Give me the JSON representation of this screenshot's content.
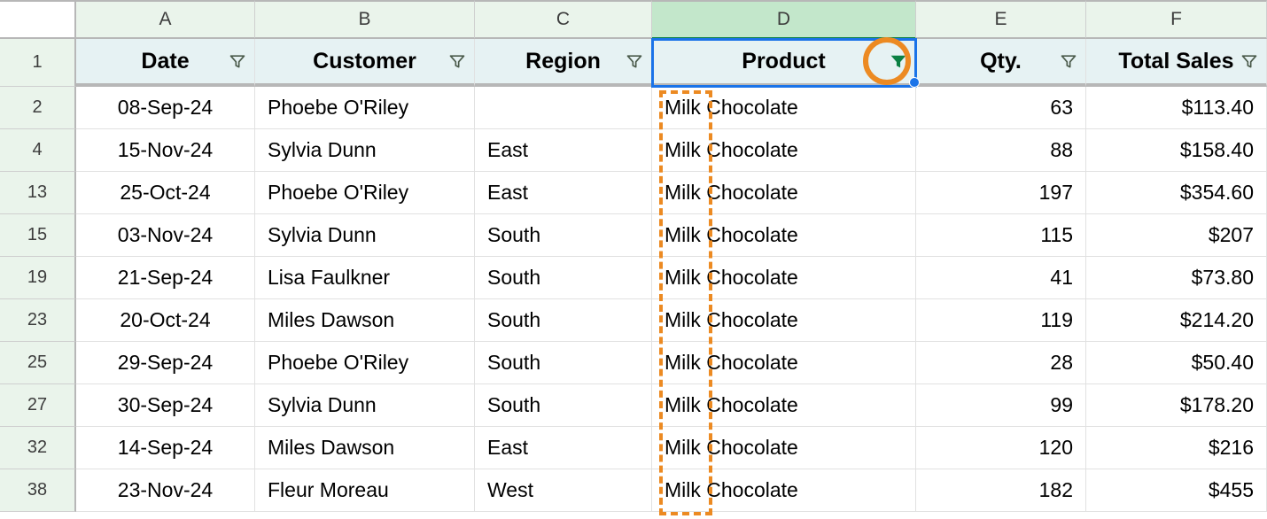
{
  "columns": {
    "letters": [
      "A",
      "B",
      "C",
      "D",
      "E",
      "F"
    ],
    "selected_index": 3,
    "headers": [
      {
        "label": "Date",
        "filter": "unfiltered"
      },
      {
        "label": "Customer",
        "filter": "unfiltered"
      },
      {
        "label": "Region",
        "filter": "unfiltered"
      },
      {
        "label": "Product",
        "filter": "active"
      },
      {
        "label": "Qty.",
        "filter": "unfiltered"
      },
      {
        "label": "Total Sales",
        "filter": "unfiltered"
      }
    ]
  },
  "rows": [
    {
      "n": 2,
      "date": "08-Sep-24",
      "customer": "Phoebe O'Riley",
      "region": "",
      "product": "Milk Chocolate",
      "qty": "63",
      "total": "$113.40"
    },
    {
      "n": 4,
      "date": "15-Nov-24",
      "customer": "Sylvia Dunn",
      "region": "East",
      "product": "Milk Chocolate",
      "qty": "88",
      "total": "$158.40"
    },
    {
      "n": 13,
      "date": "25-Oct-24",
      "customer": "Phoebe O'Riley",
      "region": "East",
      "product": "Milk Chocolate",
      "qty": "197",
      "total": "$354.60"
    },
    {
      "n": 15,
      "date": "03-Nov-24",
      "customer": "Sylvia Dunn",
      "region": "South",
      "product": "Milk Chocolate",
      "qty": "115",
      "total": "$207"
    },
    {
      "n": 19,
      "date": "21-Sep-24",
      "customer": "Lisa Faulkner",
      "region": "South",
      "product": "Milk Chocolate",
      "qty": "41",
      "total": "$73.80"
    },
    {
      "n": 23,
      "date": "20-Oct-24",
      "customer": "Miles Dawson",
      "region": "South",
      "product": "Milk Chocolate",
      "qty": "119",
      "total": "$214.20"
    },
    {
      "n": 25,
      "date": "29-Sep-24",
      "customer": "Phoebe O'Riley",
      "region": "South",
      "product": "Milk Chocolate",
      "qty": "28",
      "total": "$50.40"
    },
    {
      "n": 27,
      "date": "30-Sep-24",
      "customer": "Sylvia Dunn",
      "region": "South",
      "product": "Milk Chocolate",
      "qty": "99",
      "total": "$178.20"
    },
    {
      "n": 32,
      "date": "14-Sep-24",
      "customer": "Miles Dawson",
      "region": "East",
      "product": "Milk Chocolate",
      "qty": "120",
      "total": "$216"
    },
    {
      "n": 38,
      "date": "23-Nov-24",
      "customer": "Fleur Moreau",
      "region": "West",
      "product": "Milk Chocolate",
      "qty": "182",
      "total": "$455"
    }
  ],
  "header_row_number": "1",
  "annotations": {
    "circle_target": "product-filter-icon",
    "dashed_text_fragment": "Milk"
  }
}
